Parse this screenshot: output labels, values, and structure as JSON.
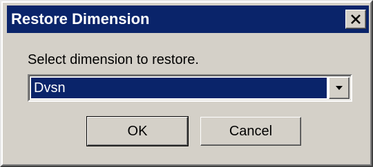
{
  "window": {
    "title": "Restore Dimension",
    "close_icon": "close-icon"
  },
  "dialog": {
    "prompt": "Select dimension to restore.",
    "dimension_select": {
      "selected_value": "Dvsn",
      "arrow_icon": "chevron-down-icon"
    },
    "ok_label": "OK",
    "cancel_label": "Cancel"
  },
  "colors": {
    "titlebar": "#0a246a",
    "face": "#d4d0c8",
    "selection": "#0a246a"
  }
}
